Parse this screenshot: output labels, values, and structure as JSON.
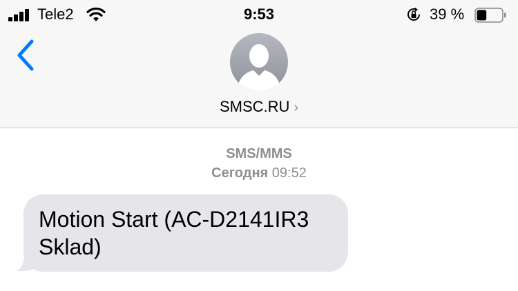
{
  "status_bar": {
    "carrier": "Tele2",
    "time": "9:53",
    "battery_percent": "39 %",
    "battery_level": 0.39,
    "signal_bars": 4,
    "icons": [
      "signal-icon",
      "wifi-icon",
      "rotation-lock-icon",
      "battery-icon"
    ]
  },
  "header": {
    "back_icon": "chevron-left-icon",
    "contact_name": "SMSC.RU",
    "contact_chevron": "›",
    "avatar_icon": "person-silhouette-icon"
  },
  "conversation": {
    "service_label": "SMS/MMS",
    "date_day": "Сегодня",
    "date_time": "09:52",
    "messages": [
      {
        "direction": "incoming",
        "text": "Motion Start (AC-D2141IR3 Sklad)"
      }
    ]
  },
  "colors": {
    "accent": "#007aff",
    "header_bg": "#f7f7f7",
    "incoming_bubble": "#e5e5ea",
    "meta_text": "#8e8e93",
    "avatar_bg": "#a3a5ad"
  }
}
